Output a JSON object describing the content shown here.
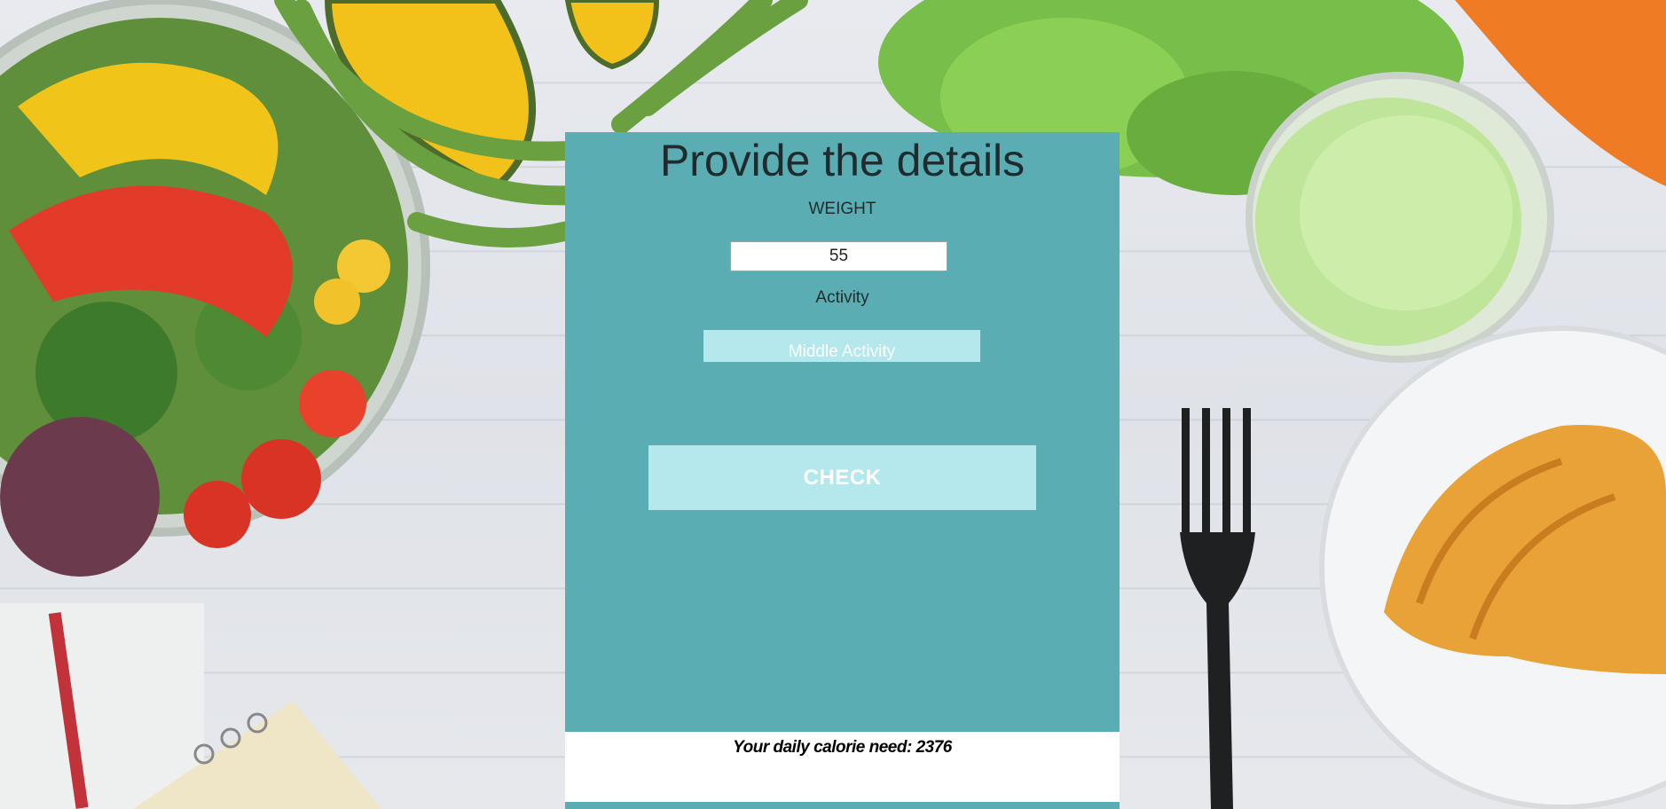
{
  "form": {
    "title": "Provide the details",
    "weight_label": "WEIGHT",
    "weight_value": "55",
    "activity_label": "Activity",
    "activity_selected": "Middle Activity",
    "check_label": "CHECK"
  },
  "result": {
    "text": "Your daily calorie need: 2376"
  },
  "colors": {
    "panel": "#5aaeb3",
    "button": "#b4e8ec",
    "button_text": "#ffffff",
    "title_text": "#1f2b2e"
  },
  "background": {
    "description_icons": [
      "salad-bowl-icon",
      "pumpkin-icon",
      "green-beans-icon",
      "lettuce-icon",
      "carrot-icon",
      "juice-glass-icon",
      "fork-icon",
      "croissant-plate-icon",
      "notebook-icon"
    ]
  }
}
